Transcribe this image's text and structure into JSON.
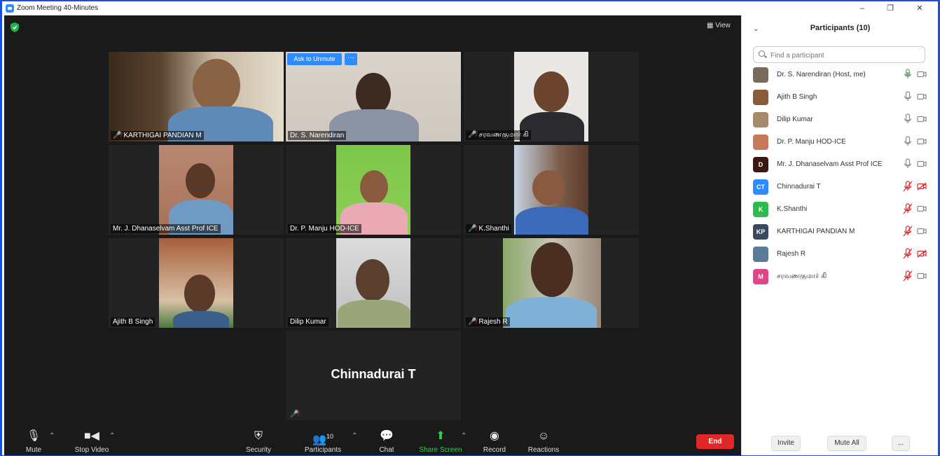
{
  "window": {
    "title": "Zoom Meeting 40-Minutes"
  },
  "meeting": {
    "view_label": "View",
    "ask_to_unmute": "Ask to Unmute",
    "more": "···"
  },
  "tiles": [
    {
      "name": "KARTHIGAI PANDIAN M",
      "muted": true
    },
    {
      "name": "Dr. S. Narendiran",
      "muted": false,
      "active": true
    },
    {
      "name": "சரவணகுமார் கி",
      "muted": true
    },
    {
      "name": "Mr. J. Dhanaselvam Asst Prof ICE",
      "muted": false
    },
    {
      "name": "Dr. P. Manju HOD-ICE",
      "muted": false
    },
    {
      "name": "K.Shanthi",
      "muted": true
    },
    {
      "name": "Ajith B Singh",
      "muted": false
    },
    {
      "name": "Dilip Kumar",
      "muted": false
    },
    {
      "name": "Rajesh R",
      "muted": true
    },
    {
      "name": "Chinnadurai T",
      "muted": true,
      "video_off": true
    }
  ],
  "toolbar": {
    "mute": "Mute",
    "stop_video": "Stop Video",
    "security": "Security",
    "participants": "Participants",
    "participants_count": "10",
    "chat": "Chat",
    "share_screen": "Share Screen",
    "record": "Record",
    "reactions": "Reactions",
    "end": "End"
  },
  "panel": {
    "title": "Participants (10)",
    "search_placeholder": "Find a participant",
    "participants": [
      {
        "name": "Dr. S. Narendiran (Host, me)",
        "initials": "",
        "avatar_color": "#7a6a5a",
        "mic": "active",
        "cam": "on"
      },
      {
        "name": "Ajith B Singh",
        "initials": "",
        "avatar_color": "#8a5a3a",
        "mic": "on",
        "cam": "on"
      },
      {
        "name": "Dilip Kumar",
        "initials": "",
        "avatar_color": "#a58b6a",
        "mic": "on",
        "cam": "on"
      },
      {
        "name": "Dr. P. Manju HOD-ICE",
        "initials": "",
        "avatar_color": "#c77a5a",
        "mic": "on",
        "cam": "on"
      },
      {
        "name": "Mr. J. Dhanaselvam Asst Prof ICE",
        "initials": "D",
        "avatar_color": "#3a1a10",
        "mic": "on",
        "cam": "on"
      },
      {
        "name": "Chinnadurai T",
        "initials": "CT",
        "avatar_color": "#2d8cff",
        "mic": "muted",
        "cam": "off"
      },
      {
        "name": "K.Shanthi",
        "initials": "K",
        "avatar_color": "#2fba4f",
        "mic": "muted",
        "cam": "on"
      },
      {
        "name": "KARTHIGAI PANDIAN M",
        "initials": "KP",
        "avatar_color": "#3a4a5e",
        "mic": "muted",
        "cam": "on"
      },
      {
        "name": "Rajesh R",
        "initials": "",
        "avatar_color": "#5a7a9a",
        "mic": "muted",
        "cam": "off"
      },
      {
        "name": "சரவணகுமார் கி",
        "initials": "M",
        "avatar_color": "#e0458a",
        "mic": "muted",
        "cam": "on"
      }
    ],
    "invite": "Invite",
    "mute_all": "Mute All",
    "more": "..."
  }
}
